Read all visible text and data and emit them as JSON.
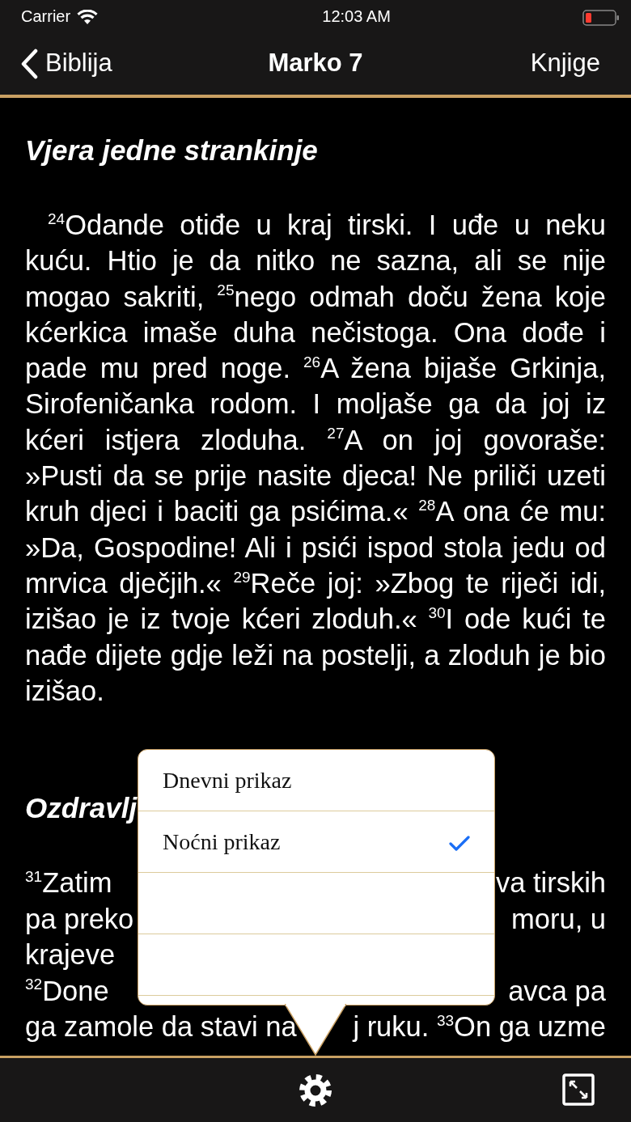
{
  "status_bar": {
    "carrier": "Carrier",
    "time": "12:03 AM"
  },
  "nav_bar": {
    "back": "Biblija",
    "title": "Marko 7",
    "right": "Knjige"
  },
  "section": {
    "heading": "Vjera jedne strankinje",
    "paragraph": "$^{24}$Odande otiđe u kraj tirski. I uđe u neku kuću. Htio je da nitko ne sazna, ali se nije mogao sakriti, $^{25}$nego odmah doču žena koje kćerkica imaše duha nečistoga. Ona dođe i pade mu pred noge. $^{26}$A žena bijaše Grkinja, Sirofeničanka rodom. I moljaše ga da joj iz kćeri istjera zloduha. $^{27}$A on joj govoraše: »Pusti da se prije nasite djeca! Ne priliči uzeti kruh djeci i baciti ga psićima.« $^{28}$A ona će mu: »Da, Gospodine! Ali i psići ispod stola jedu od mrvica dječjih.« $^{29}$Reče joj: »Zbog te riječi idi, izišao je iz tvoje kćeri zloduh.« $^{30}$I ode kući te nađe dijete gdje leži na postelji, a zloduh je bio izišao."
  },
  "covered_section": {
    "heading": "Ozdravlj",
    "lines": [
      {
        "left": "$^{31}$Zatim",
        "right": "va tirskih"
      },
      {
        "left": "pa preko",
        "right": "moru, u"
      },
      {
        "left": "krajeve"
      },
      {
        "left": "$^{32}$Done",
        "right": "avca pa"
      },
      {
        "left": "ga zamole da stavi na",
        "right": "j ruku. $^{33}$On ga uzme"
      }
    ]
  },
  "popover": {
    "items": [
      {
        "kind": "option",
        "label": "Dnevni prikaz",
        "selected": false
      },
      {
        "kind": "option",
        "label": "Noćni prikaz",
        "selected": true
      },
      {
        "kind": "blank"
      },
      {
        "kind": "blank"
      }
    ]
  }
}
